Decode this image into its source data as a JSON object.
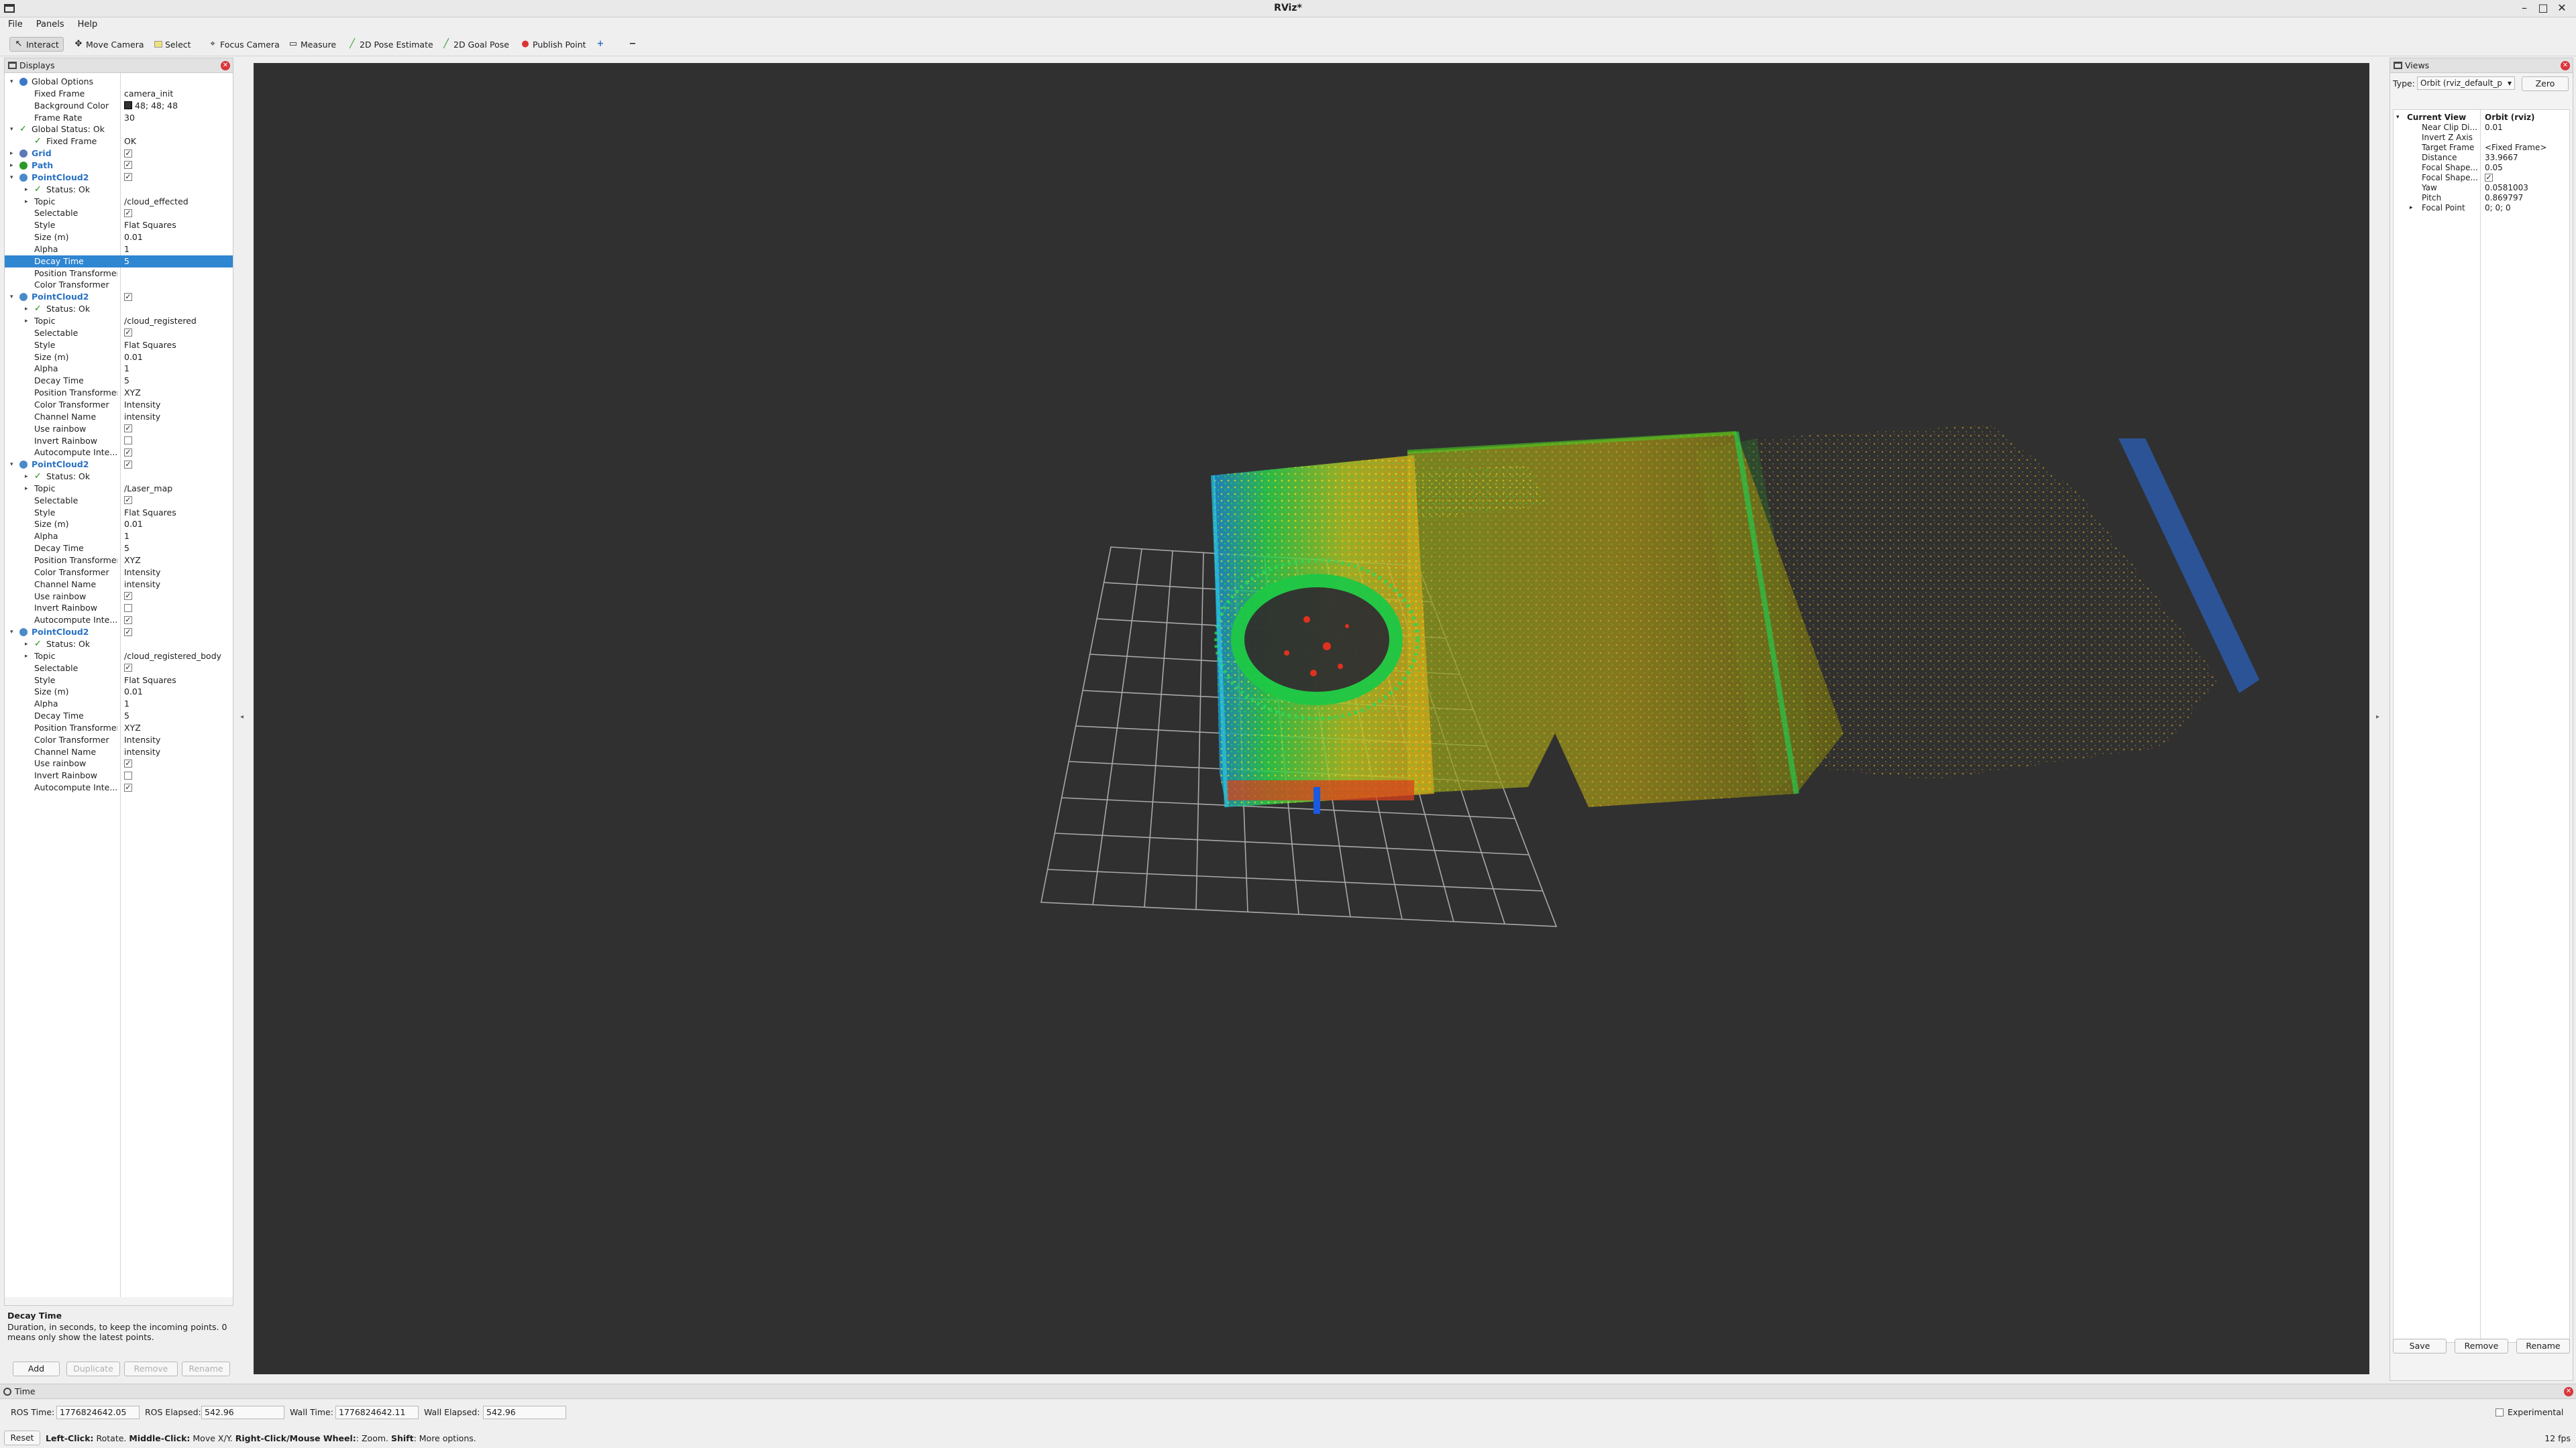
{
  "window": {
    "title": "RViz*"
  },
  "menu": [
    "File",
    "Panels",
    "Help"
  ],
  "toolbar": [
    {
      "label": "Interact",
      "icon": "interact-icon"
    },
    {
      "label": "Move Camera",
      "icon": "move-camera-icon"
    },
    {
      "label": "Select",
      "icon": "select-icon"
    },
    {
      "label": "Focus Camera",
      "icon": "focus-camera-icon"
    },
    {
      "label": "Measure",
      "icon": "measure-icon"
    },
    {
      "label": "2D Pose Estimate",
      "icon": "pose-estimate-icon"
    },
    {
      "label": "2D Goal Pose",
      "icon": "goal-pose-icon"
    },
    {
      "label": "Publish Point",
      "icon": "publish-point-icon"
    }
  ],
  "displays": {
    "title": "Displays",
    "rows": [
      {
        "d": 0,
        "arrow": "down",
        "icon": "globe",
        "k": "Global Options",
        "v": ""
      },
      {
        "d": 1,
        "k": "Fixed Frame",
        "v": "camera_init"
      },
      {
        "d": 1,
        "k": "Background Color",
        "v": "48; 48; 48",
        "swatch": true
      },
      {
        "d": 1,
        "k": "Frame Rate",
        "v": "30"
      },
      {
        "d": 0,
        "arrow": "down",
        "check": true,
        "k": "Global Status: Ok",
        "v": ""
      },
      {
        "d": 1,
        "check": true,
        "k": "Fixed Frame",
        "v": "OK"
      },
      {
        "d": 0,
        "arrow": "right",
        "icon": "grid",
        "k": "Grid",
        "v": "",
        "blue": true,
        "cb": true
      },
      {
        "d": 0,
        "arrow": "right",
        "icon": "path",
        "k": "Path",
        "v": "",
        "blue": true,
        "cb": true
      },
      {
        "d": 0,
        "arrow": "down",
        "icon": "pc",
        "k": "PointCloud2",
        "v": "",
        "blue": true,
        "cb": true
      },
      {
        "d": 1,
        "arrow": "right",
        "check": true,
        "k": "Status: Ok",
        "v": ""
      },
      {
        "d": 1,
        "arrow": "right",
        "k": "Topic",
        "v": "/cloud_effected"
      },
      {
        "d": 1,
        "k": "Selectable",
        "v": "",
        "cb": true
      },
      {
        "d": 1,
        "k": "Style",
        "v": "Flat Squares"
      },
      {
        "d": 1,
        "k": "Size (m)",
        "v": "0.01"
      },
      {
        "d": 1,
        "k": "Alpha",
        "v": "1"
      },
      {
        "d": 1,
        "k": "Decay Time",
        "v": "5",
        "sel": true
      },
      {
        "d": 1,
        "k": "Position Transformer",
        "v": ""
      },
      {
        "d": 1,
        "k": "Color Transformer",
        "v": ""
      },
      {
        "d": 0,
        "arrow": "down",
        "icon": "pc",
        "k": "PointCloud2",
        "v": "",
        "blue": true,
        "cb": true
      },
      {
        "d": 1,
        "arrow": "right",
        "check": true,
        "k": "Status: Ok",
        "v": ""
      },
      {
        "d": 1,
        "arrow": "right",
        "k": "Topic",
        "v": "/cloud_registered"
      },
      {
        "d": 1,
        "k": "Selectable",
        "v": "",
        "cb": true
      },
      {
        "d": 1,
        "k": "Style",
        "v": "Flat Squares"
      },
      {
        "d": 1,
        "k": "Size (m)",
        "v": "0.01"
      },
      {
        "d": 1,
        "k": "Alpha",
        "v": "1"
      },
      {
        "d": 1,
        "k": "Decay Time",
        "v": "5"
      },
      {
        "d": 1,
        "k": "Position Transformer",
        "v": "XYZ"
      },
      {
        "d": 1,
        "k": "Color Transformer",
        "v": "Intensity"
      },
      {
        "d": 1,
        "k": "Channel Name",
        "v": "intensity"
      },
      {
        "d": 1,
        "k": "Use rainbow",
        "v": "",
        "cb": true
      },
      {
        "d": 1,
        "k": "Invert Rainbow",
        "v": "",
        "cbEmpty": true
      },
      {
        "d": 1,
        "k": "Autocompute Inte...",
        "v": "",
        "cb": true
      },
      {
        "d": 0,
        "arrow": "down",
        "icon": "pc",
        "k": "PointCloud2",
        "v": "",
        "blue": true,
        "cb": true
      },
      {
        "d": 1,
        "arrow": "right",
        "check": true,
        "k": "Status: Ok",
        "v": ""
      },
      {
        "d": 1,
        "arrow": "right",
        "k": "Topic",
        "v": "/Laser_map"
      },
      {
        "d": 1,
        "k": "Selectable",
        "v": "",
        "cb": true
      },
      {
        "d": 1,
        "k": "Style",
        "v": "Flat Squares"
      },
      {
        "d": 1,
        "k": "Size (m)",
        "v": "0.01"
      },
      {
        "d": 1,
        "k": "Alpha",
        "v": "1"
      },
      {
        "d": 1,
        "k": "Decay Time",
        "v": "5"
      },
      {
        "d": 1,
        "k": "Position Transformer",
        "v": "XYZ"
      },
      {
        "d": 1,
        "k": "Color Transformer",
        "v": "Intensity"
      },
      {
        "d": 1,
        "k": "Channel Name",
        "v": "intensity"
      },
      {
        "d": 1,
        "k": "Use rainbow",
        "v": "",
        "cb": true
      },
      {
        "d": 1,
        "k": "Invert Rainbow",
        "v": "",
        "cbEmpty": true
      },
      {
        "d": 1,
        "k": "Autocompute Inte...",
        "v": "",
        "cb": true
      },
      {
        "d": 0,
        "arrow": "down",
        "icon": "pc",
        "k": "PointCloud2",
        "v": "",
        "blue": true,
        "cb": true
      },
      {
        "d": 1,
        "arrow": "right",
        "check": true,
        "k": "Status: Ok",
        "v": ""
      },
      {
        "d": 1,
        "arrow": "right",
        "k": "Topic",
        "v": "/cloud_registered_body"
      },
      {
        "d": 1,
        "k": "Selectable",
        "v": "",
        "cb": true
      },
      {
        "d": 1,
        "k": "Style",
        "v": "Flat Squares"
      },
      {
        "d": 1,
        "k": "Size (m)",
        "v": "0.01"
      },
      {
        "d": 1,
        "k": "Alpha",
        "v": "1"
      },
      {
        "d": 1,
        "k": "Decay Time",
        "v": "5"
      },
      {
        "d": 1,
        "k": "Position Transformer",
        "v": "XYZ"
      },
      {
        "d": 1,
        "k": "Color Transformer",
        "v": "Intensity"
      },
      {
        "d": 1,
        "k": "Channel Name",
        "v": "intensity"
      },
      {
        "d": 1,
        "k": "Use rainbow",
        "v": "",
        "cb": true
      },
      {
        "d": 1,
        "k": "Invert Rainbow",
        "v": "",
        "cbEmpty": true
      },
      {
        "d": 1,
        "k": "Autocompute Inte...",
        "v": "",
        "cb": true
      }
    ],
    "help_title": "Decay Time",
    "help_text": "Duration, in seconds, to keep the incoming points. 0 means only show the latest points.",
    "buttons": {
      "add": "Add",
      "duplicate": "Duplicate",
      "remove": "Remove",
      "rename": "Rename"
    }
  },
  "views": {
    "title": "Views",
    "type_label": "Type:",
    "type_value": "Orbit (rviz_default_p",
    "zero": "Zero",
    "current_view": "Current View",
    "current_view_type": "Orbit (rviz)",
    "props": [
      {
        "k": "Near Clip Di...",
        "v": "0.01"
      },
      {
        "k": "Invert Z Axis",
        "v": ""
      },
      {
        "k": "Target Frame",
        "v": "<Fixed Frame>"
      },
      {
        "k": "Distance",
        "v": "33.9667"
      },
      {
        "k": "Focal Shape...",
        "v": "0.05"
      },
      {
        "k": "Focal Shape...",
        "v": "",
        "cb": true
      },
      {
        "k": "Yaw",
        "v": "0.0581003"
      },
      {
        "k": "Pitch",
        "v": "0.869797"
      },
      {
        "k": "Focal Point",
        "v": "0; 0; 0",
        "arrow": true
      }
    ],
    "buttons": {
      "save": "Save",
      "remove": "Remove",
      "rename": "Rename"
    }
  },
  "time": {
    "title": "Time",
    "ros_time_label": "ROS Time:",
    "ros_time": "1776824642.05",
    "ros_elapsed_label": "ROS Elapsed:",
    "ros_elapsed": "542.96",
    "wall_time_label": "Wall Time:",
    "wall_time": "1776824642.11",
    "wall_elapsed_label": "Wall Elapsed:",
    "wall_elapsed": "542.96",
    "experimental": "Experimental"
  },
  "status": {
    "reset": "Reset",
    "hint_b1": "Left-Click:",
    "hint_t1": " Rotate. ",
    "hint_b2": "Middle-Click:",
    "hint_t2": " Move X/Y. ",
    "hint_b3": "Right-Click/Mouse Wheel:",
    "hint_t3": ": Zoom. ",
    "hint_b4": "Shift",
    "hint_t4": ": More options.",
    "fps": "12 fps"
  },
  "colors": {
    "render_bg": "#303030",
    "selection": "#2f86d1",
    "link": "#2a72c4"
  }
}
